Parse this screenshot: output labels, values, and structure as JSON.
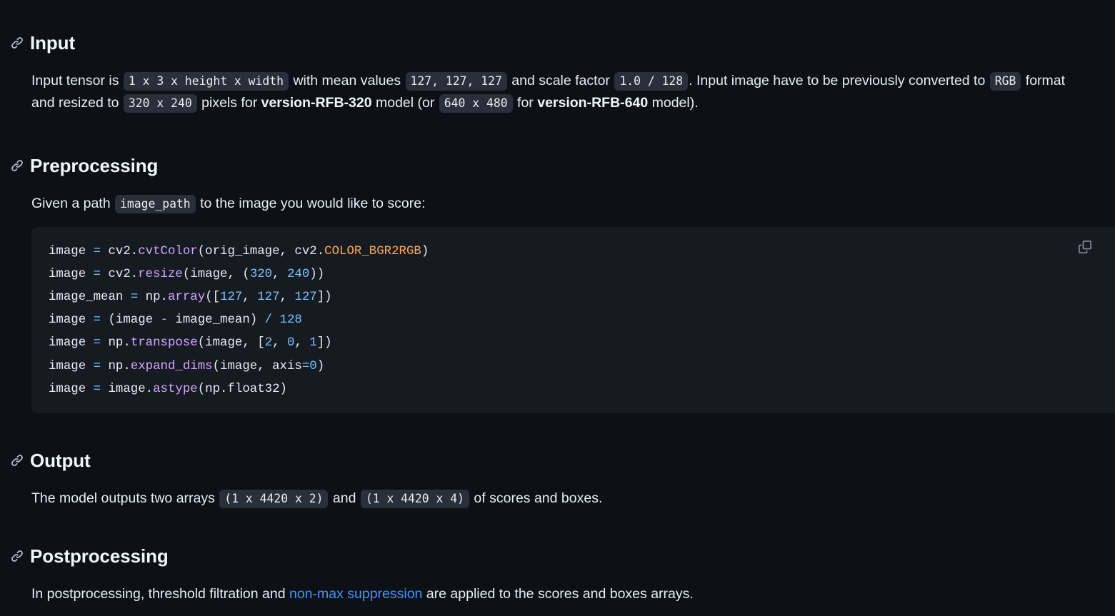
{
  "theme": {
    "page_bg": "#0d1117",
    "code_bg": "#161b22",
    "text": "#e6edf3",
    "heading": "#f0f6fc",
    "link": "#4493f8",
    "chip_bg": "#2a3039",
    "token_function": "#d2a8ff",
    "token_number": "#79c0ff",
    "token_operator": "#79c0ff",
    "token_constant": "#ffa657",
    "copy_icon": "#848d97"
  },
  "sections": {
    "input": {
      "heading": "Input",
      "anchor_icon": "link-icon",
      "paragraph": {
        "p1": "Input tensor is",
        "c1": "1 x 3 x height x width",
        "p2": "with mean values",
        "c2": "127, 127, 127",
        "p3": "and scale factor",
        "c3": "1.0 / 128",
        "p4": ". Input image have to be previously converted to",
        "c4": "RGB",
        "p5": "format and resized to",
        "c5": "320 x 240",
        "p6": "pixels for",
        "b1": "version-RFB-320",
        "p7": "model (or",
        "c6": "640 x 480",
        "p8": "for",
        "b2": "version-RFB-640",
        "p9": "model)."
      }
    },
    "preprocessing": {
      "heading": "Preprocessing",
      "anchor_icon": "link-icon",
      "paragraph": {
        "p1": "Given a path",
        "c1": "image_path",
        "p2": "to the image you would like to score:"
      },
      "code_block": {
        "language": "python",
        "copy_label": "copy-icon",
        "lines": [
          [
            {
              "t": "image ",
              "c": "plain"
            },
            {
              "t": "=",
              "c": "op"
            },
            {
              "t": " cv2.",
              "c": "plain"
            },
            {
              "t": "cvtColor",
              "c": "fn"
            },
            {
              "t": "(orig_image, cv2.",
              "c": "plain"
            },
            {
              "t": "COLOR_BGR2RGB",
              "c": "const"
            },
            {
              "t": ")",
              "c": "plain"
            }
          ],
          [
            {
              "t": "image ",
              "c": "plain"
            },
            {
              "t": "=",
              "c": "op"
            },
            {
              "t": " cv2.",
              "c": "plain"
            },
            {
              "t": "resize",
              "c": "fn"
            },
            {
              "t": "(image, (",
              "c": "plain"
            },
            {
              "t": "320",
              "c": "num"
            },
            {
              "t": ", ",
              "c": "plain"
            },
            {
              "t": "240",
              "c": "num"
            },
            {
              "t": "))",
              "c": "plain"
            }
          ],
          [
            {
              "t": "image_mean ",
              "c": "plain"
            },
            {
              "t": "=",
              "c": "op"
            },
            {
              "t": " np.",
              "c": "plain"
            },
            {
              "t": "array",
              "c": "fn"
            },
            {
              "t": "([",
              "c": "plain"
            },
            {
              "t": "127",
              "c": "num"
            },
            {
              "t": ", ",
              "c": "plain"
            },
            {
              "t": "127",
              "c": "num"
            },
            {
              "t": ", ",
              "c": "plain"
            },
            {
              "t": "127",
              "c": "num"
            },
            {
              "t": "])",
              "c": "plain"
            }
          ],
          [
            {
              "t": "image ",
              "c": "plain"
            },
            {
              "t": "=",
              "c": "op"
            },
            {
              "t": " (image ",
              "c": "plain"
            },
            {
              "t": "-",
              "c": "op"
            },
            {
              "t": " image_mean) ",
              "c": "plain"
            },
            {
              "t": "/",
              "c": "op"
            },
            {
              "t": " ",
              "c": "plain"
            },
            {
              "t": "128",
              "c": "num"
            }
          ],
          [
            {
              "t": "image ",
              "c": "plain"
            },
            {
              "t": "=",
              "c": "op"
            },
            {
              "t": " np.",
              "c": "plain"
            },
            {
              "t": "transpose",
              "c": "fn"
            },
            {
              "t": "(image, [",
              "c": "plain"
            },
            {
              "t": "2",
              "c": "num"
            },
            {
              "t": ", ",
              "c": "plain"
            },
            {
              "t": "0",
              "c": "num"
            },
            {
              "t": ", ",
              "c": "plain"
            },
            {
              "t": "1",
              "c": "num"
            },
            {
              "t": "])",
              "c": "plain"
            }
          ],
          [
            {
              "t": "image ",
              "c": "plain"
            },
            {
              "t": "=",
              "c": "op"
            },
            {
              "t": " np.",
              "c": "plain"
            },
            {
              "t": "expand_dims",
              "c": "fn"
            },
            {
              "t": "(image, axis",
              "c": "plain"
            },
            {
              "t": "=",
              "c": "op"
            },
            {
              "t": "0",
              "c": "num"
            },
            {
              "t": ")",
              "c": "plain"
            }
          ],
          [
            {
              "t": "image ",
              "c": "plain"
            },
            {
              "t": "=",
              "c": "op"
            },
            {
              "t": " image.",
              "c": "plain"
            },
            {
              "t": "astype",
              "c": "fn"
            },
            {
              "t": "(np.float32)",
              "c": "plain"
            }
          ]
        ]
      }
    },
    "output": {
      "heading": "Output",
      "anchor_icon": "link-icon",
      "paragraph": {
        "p1": "The model outputs two arrays",
        "c1": "(1 x 4420 x 2)",
        "p2": "and",
        "c2": "(1 x 4420 x 4)",
        "p3": "of scores and boxes."
      }
    },
    "postprocessing": {
      "heading": "Postprocessing",
      "anchor_icon": "link-icon",
      "paragraph": {
        "p1": "In postprocessing, threshold filtration and",
        "link": "non-max suppression",
        "p2": "are applied to the scores and boxes arrays."
      }
    }
  }
}
